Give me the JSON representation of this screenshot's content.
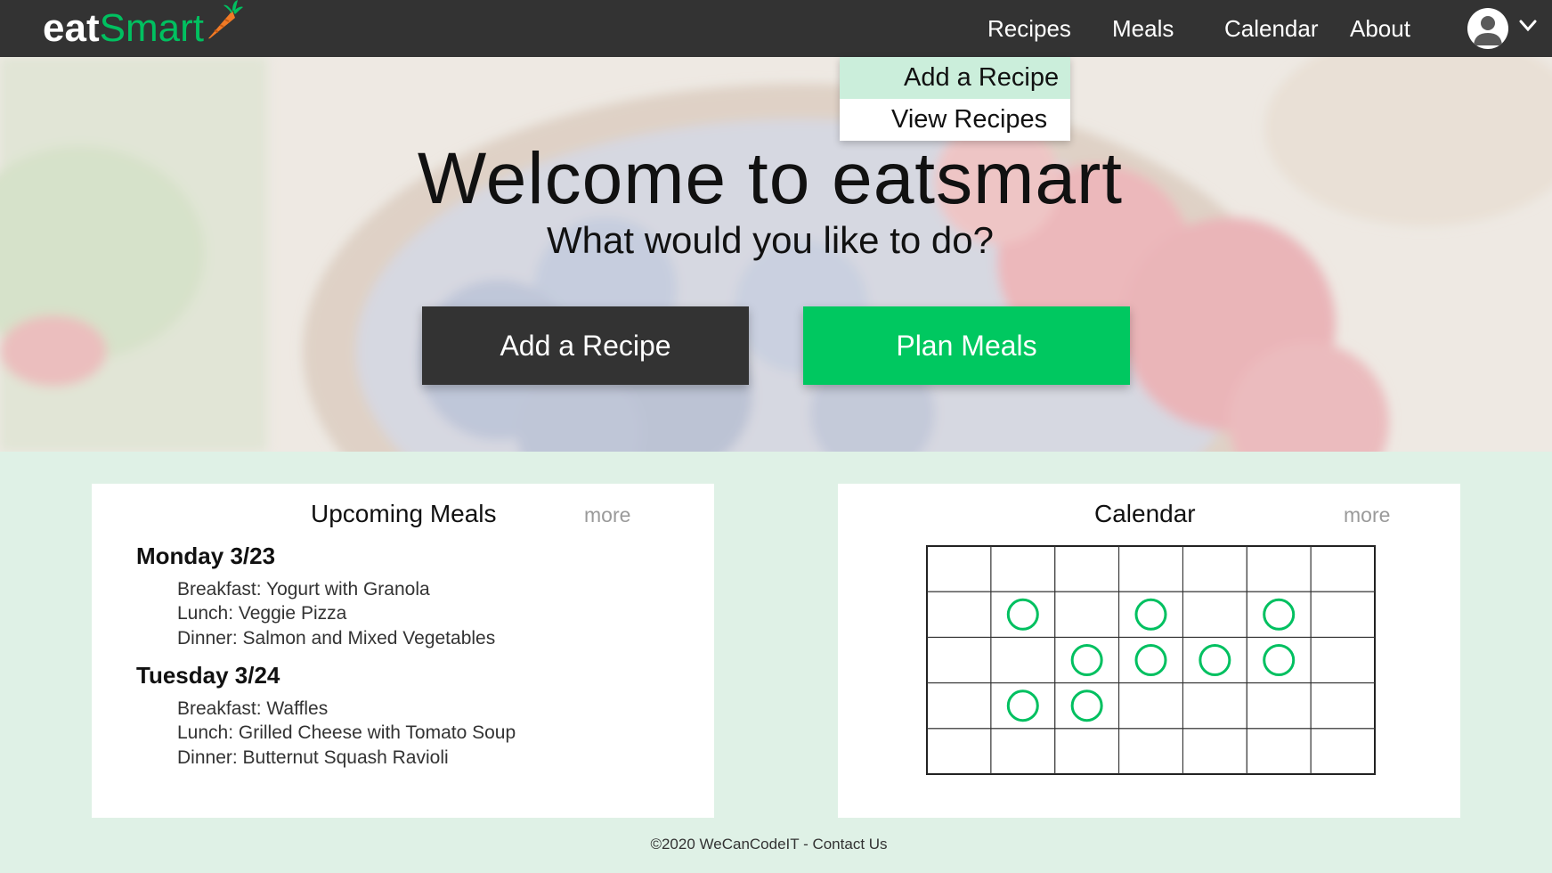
{
  "nav": {
    "logo_eat": "eat",
    "logo_smart": "Smart",
    "links": [
      "Recipes",
      "Meals",
      "Calendar",
      "About"
    ]
  },
  "dropdown": {
    "items": [
      "Add a Recipe",
      "View Recipes"
    ]
  },
  "hero": {
    "title": "Welcome to eatsmart",
    "subtitle": "What would you like to do?",
    "primary_button": "Add a Recipe",
    "secondary_button": "Plan Meals"
  },
  "upcoming": {
    "title": "Upcoming Meals",
    "more": "more",
    "days": [
      {
        "label": "Monday 3/23",
        "meals": [
          "Breakfast:  Yogurt with Granola",
          "Lunch: Veggie Pizza",
          "Dinner: Salmon and Mixed Vegetables"
        ]
      },
      {
        "label": "Tuesday 3/24",
        "meals": [
          "Breakfast:  Waffles",
          "Lunch: Grilled Cheese with Tomato Soup",
          "Dinner: Butternut Squash Ravioli"
        ]
      }
    ]
  },
  "calendar": {
    "title": "Calendar",
    "more": "more",
    "rows": 5,
    "cols": 7,
    "marked_cells": [
      [
        1,
        1
      ],
      [
        1,
        3
      ],
      [
        1,
        5
      ],
      [
        2,
        2
      ],
      [
        2,
        3
      ],
      [
        2,
        4
      ],
      [
        2,
        5
      ],
      [
        3,
        1
      ],
      [
        3,
        2
      ]
    ]
  },
  "footer": {
    "copyright": "©2020 WeCanCodeIT - ",
    "contact": "Contact Us"
  },
  "colors": {
    "navbar": "#333333",
    "brand_green": "#00c860",
    "page_bg": "#dff1e6",
    "dropdown_active": "#cbeedb",
    "marker": "#00c060"
  },
  "icons": [
    "carrot-icon",
    "user-avatar-icon",
    "chevron-down-icon"
  ]
}
